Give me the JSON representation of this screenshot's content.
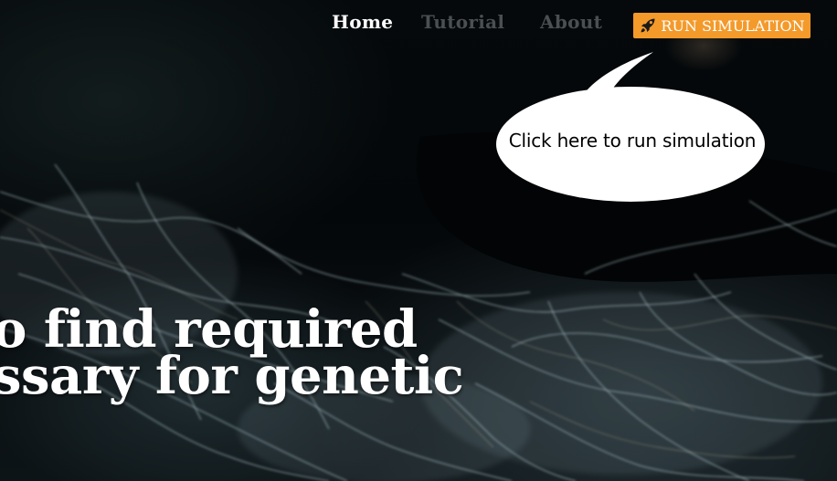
{
  "nav": {
    "items": [
      {
        "label": "Home",
        "active": true
      },
      {
        "label": "Tutorial",
        "active": false
      },
      {
        "label": "About",
        "active": false
      }
    ],
    "run_button": {
      "label": "RUN SIMULATION",
      "icon": "rocket-icon",
      "color": "#f39a2b"
    }
  },
  "callout": {
    "text": "Click here to run simulation"
  },
  "hero": {
    "lines": [
      "o find required",
      "ssary for genetic"
    ]
  },
  "colors": {
    "active_link": "#ffffff",
    "inactive_link": "#4a4f52",
    "accent": "#f39a2b"
  }
}
